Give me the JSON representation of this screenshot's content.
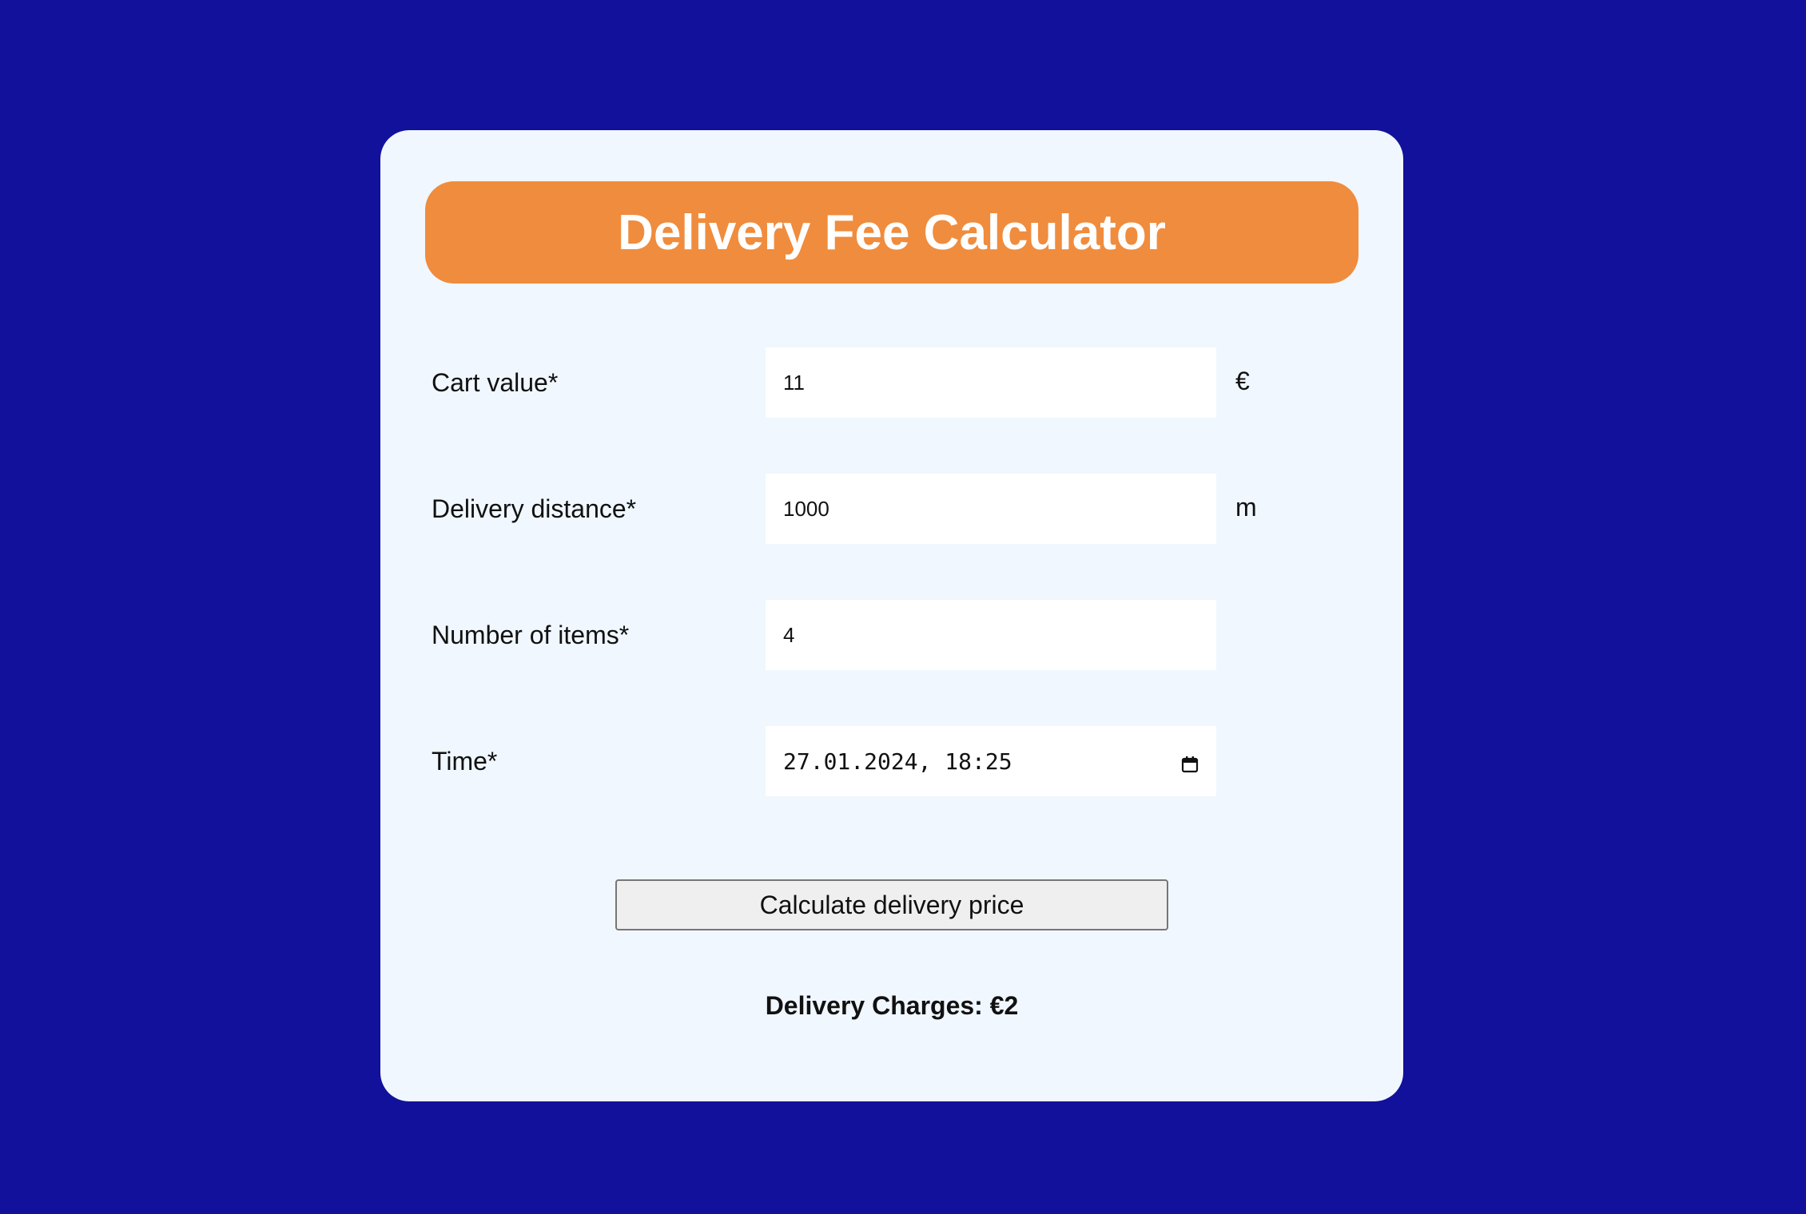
{
  "colors": {
    "background": "#12119b",
    "card": "#f0f7fe",
    "header": "#f08c3d",
    "header_text": "#ffffff"
  },
  "header": {
    "title": "Delivery Fee Calculator"
  },
  "form": {
    "cart_value": {
      "label": "Cart value*",
      "value": "11",
      "unit": "€"
    },
    "delivery_distance": {
      "label": "Delivery distance*",
      "value": "1000",
      "unit": "m"
    },
    "number_of_items": {
      "label": "Number of items*",
      "value": "4"
    },
    "time": {
      "label": "Time*",
      "value": "27.01.2024, 18:25",
      "icon": "calendar-icon"
    }
  },
  "button": {
    "label": "Calculate delivery price"
  },
  "result": {
    "text": "Delivery Charges: €2"
  }
}
